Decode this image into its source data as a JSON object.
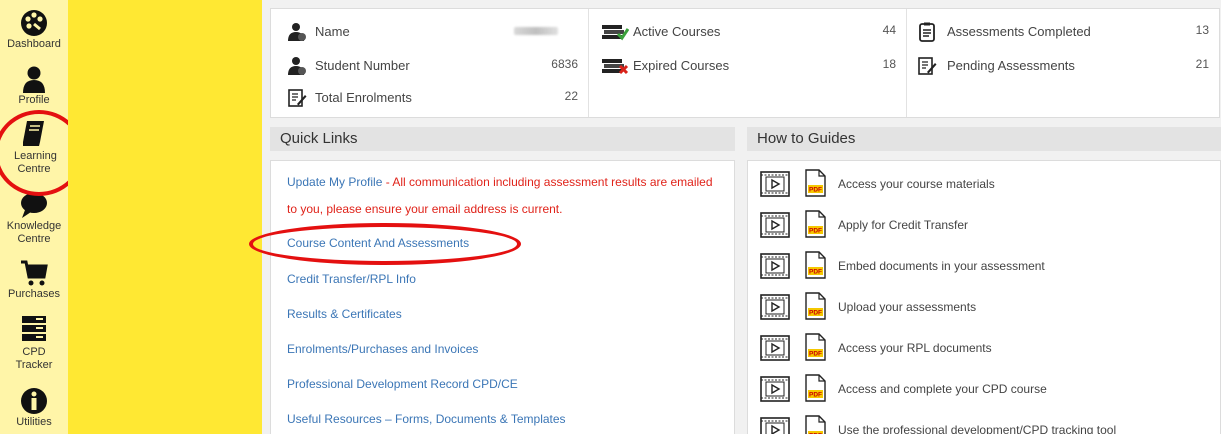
{
  "sidebar": {
    "items": [
      {
        "label": "Dashboard",
        "icon": "palette-icon"
      },
      {
        "label": "Profile",
        "icon": "user-icon"
      },
      {
        "label": "Learning Centre",
        "icon": "book-icon"
      },
      {
        "label": "Knowledge Centre",
        "icon": "speech-bubble-icon"
      },
      {
        "label": "Purchases",
        "icon": "cart-icon"
      },
      {
        "label": "CPD Tracker",
        "icon": "server-stack-icon"
      },
      {
        "label": "Utilities",
        "icon": "info-icon"
      }
    ]
  },
  "stats": {
    "name_label": "Name",
    "student_number_label": "Student Number",
    "student_number_value": "6836",
    "total_enrolments_label": "Total Enrolments",
    "total_enrolments_value": "22",
    "active_courses_label": "Active Courses",
    "active_courses_value": "44",
    "expired_courses_label": "Expired Courses",
    "expired_courses_value": "18",
    "assessments_completed_label": "Assessments Completed",
    "assessments_completed_value": "13",
    "pending_assessments_label": "Pending Assessments",
    "pending_assessments_value": "21"
  },
  "quick_links": {
    "title": "Quick Links",
    "update_profile": "Update My Profile",
    "update_note_line1": " - All communication including assessment results are emailed",
    "update_note_line2": "to you, please ensure your email address is current.",
    "items": [
      "Course Content And Assessments",
      "Credit Transfer/RPL Info",
      "Results & Certificates",
      "Enrolments/Purchases and Invoices",
      "Professional Development Record CPD/CE",
      "Useful Resources – Forms, Documents & Templates"
    ]
  },
  "guides": {
    "title": "How to Guides",
    "items": [
      "Access your course materials",
      "Apply for Credit Transfer",
      "Embed documents in your assessment",
      "Upload your assessments",
      "Access your RPL documents",
      "Access and complete your CPD course",
      "Use the professional development/CPD tracking tool"
    ]
  },
  "colors": {
    "rail_bg": "#fff5a8",
    "band_bg": "#ffe833",
    "link_blue": "#3b76b6",
    "note_red": "#e0231a",
    "highlight_red": "#e41010"
  }
}
